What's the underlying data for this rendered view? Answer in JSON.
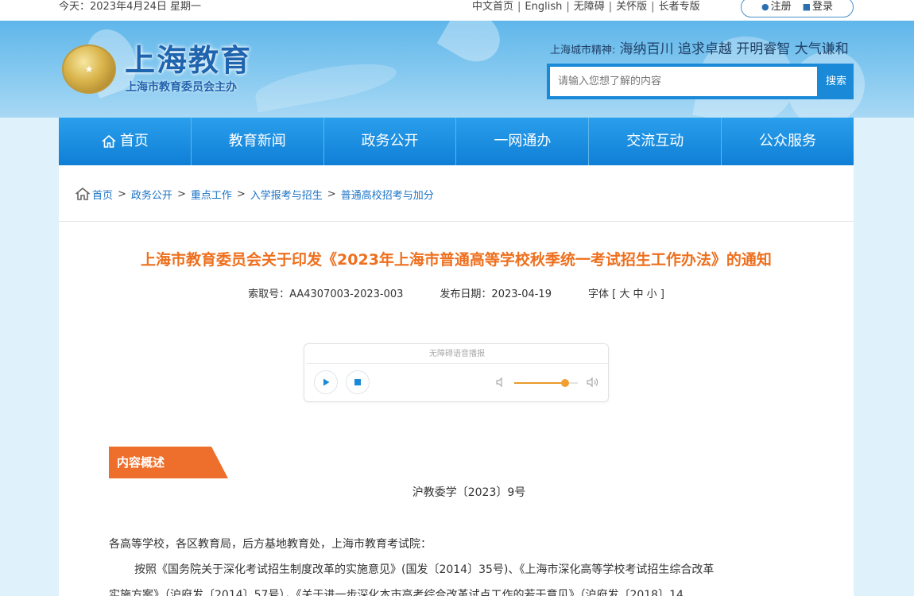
{
  "topbar": {
    "today": "今天：2023年4月24日 星期一",
    "links": [
      "中文首页",
      "English",
      "无障碍",
      "关怀版",
      "长者专版"
    ],
    "register": "注册",
    "login": "登录"
  },
  "header": {
    "logo_text": "上海教育",
    "logo_sub": "上海市教育委员会主办",
    "spirit_label": "上海城市精神:",
    "spirit_value": "海纳百川 追求卓越 开明睿智 大气谦和",
    "search_placeholder": "请输入您想了解的内容",
    "search_button": "搜索"
  },
  "nav": {
    "items": [
      "首页",
      "教育新闻",
      "政务公开",
      "一网通办",
      "交流互动",
      "公众服务"
    ]
  },
  "breadcrumb": [
    "首页",
    "政务公开",
    "重点工作",
    "入学报考与招生",
    "普通高校招考与加分"
  ],
  "article": {
    "title": "上海市教育委员会关于印发《2023年上海市普通高等学校秋季统一考试招生工作办法》的通知",
    "index_no": "索取号：AA4307003-2023-003",
    "publish_date": "发布日期：2023-04-19",
    "font_label": "字体 [",
    "font_large": "大",
    "font_medium": "中",
    "font_small": "小",
    "font_close": "]",
    "section_label": "内容概述",
    "doc_number": "沪教委学〔2023〕9号",
    "recipients": "各高等学校，各区教育局，后方基地教育处，上海市教育考试院：",
    "body_line1": "按照《国务院关于深化考试招生制度改革的实施意见》(国发〔2014〕35号)、《上海市深化高等学校考试招生综合改革",
    "body_line2": "实施方案》（沪府发〔2014〕57号），《关于进一步深化本市高考综合改革试点工作的若干意见》（沪府发〔2018〕14"
  },
  "player": {
    "label": "无障碍语音播报",
    "volume": 0.8
  },
  "colors": {
    "accent_blue": "#1a8ad8",
    "title_orange": "#ee6f1d",
    "section_orange": "#ee6f2b",
    "link_blue": "#1a73c7"
  }
}
